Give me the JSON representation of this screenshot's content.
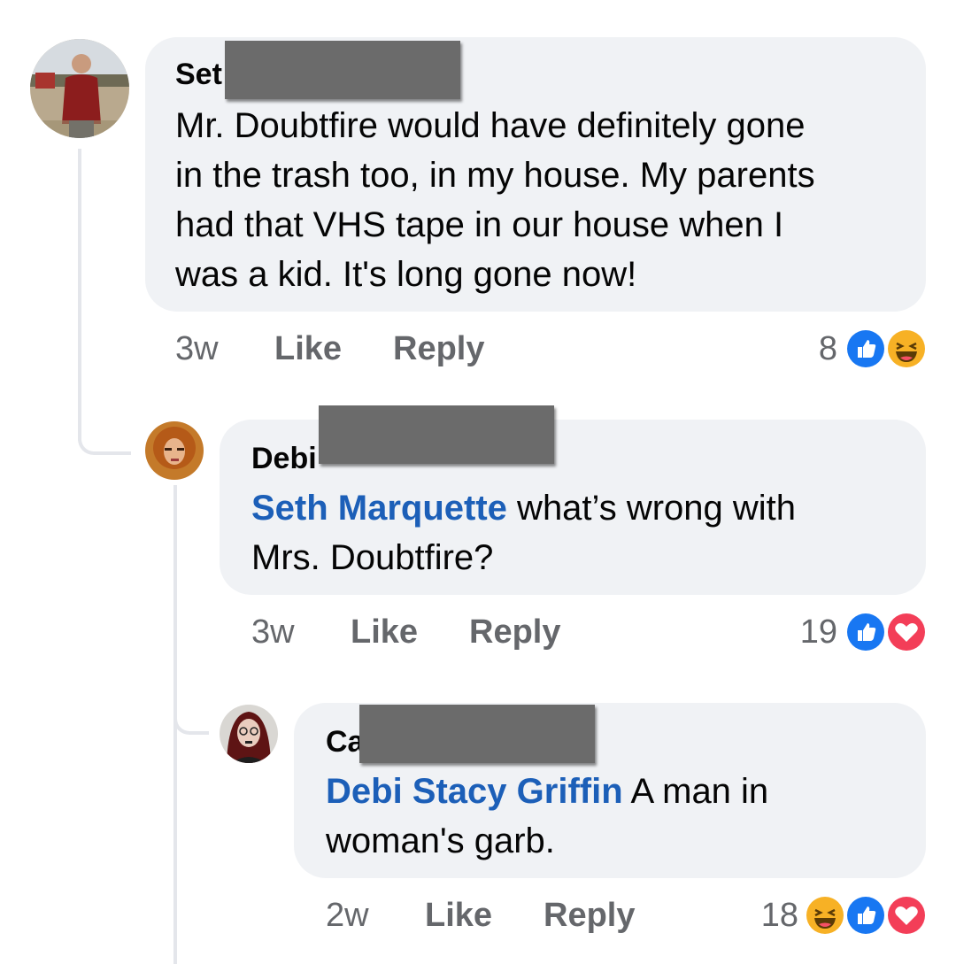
{
  "comments": [
    {
      "author_visible": "Set",
      "text": "Mr. Doubtfire would have definitely gone in the trash too, in my house. My parents had that VHS tape in our house when I was a kid. It's long gone now!",
      "lines": [
        "Mr. Doubtfire would have definitely gone",
        "in the trash too, in my house. My parents",
        "had that VHS tape in our house when I",
        "was a kid. It's long gone now!"
      ],
      "time": "3w",
      "like_label": "Like",
      "reply_label": "Reply",
      "reaction_count": "8",
      "reactions": [
        "like-icon",
        "haha-icon"
      ]
    },
    {
      "author_visible": "Debi",
      "mention": "Seth Marquette",
      "lines_after_mention": [
        " what’s wrong with",
        "Mrs. Doubtfire?"
      ],
      "time": "3w",
      "like_label": "Like",
      "reply_label": "Reply",
      "reaction_count": "19",
      "reactions": [
        "like-icon",
        "love-icon"
      ]
    },
    {
      "author_visible": "Ca",
      "mention": "Debi Stacy Griffin",
      "lines_after_mention": [
        " A man in",
        "woman's garb."
      ],
      "time": "2w",
      "like_label": "Like",
      "reply_label": "Reply",
      "reaction_count": "18",
      "reactions": [
        "haha-icon",
        "like-icon",
        "love-icon"
      ]
    }
  ],
  "colors": {
    "bubble": "#f0f2f5",
    "mention": "#1c5fb8",
    "meta_text": "#65676b",
    "thread_line": "#e4e6eb",
    "like_blue": "#1877f2",
    "love_red": "#f33e58",
    "haha_yellow": "#f7b125",
    "redaction": "#6b6b6b"
  }
}
